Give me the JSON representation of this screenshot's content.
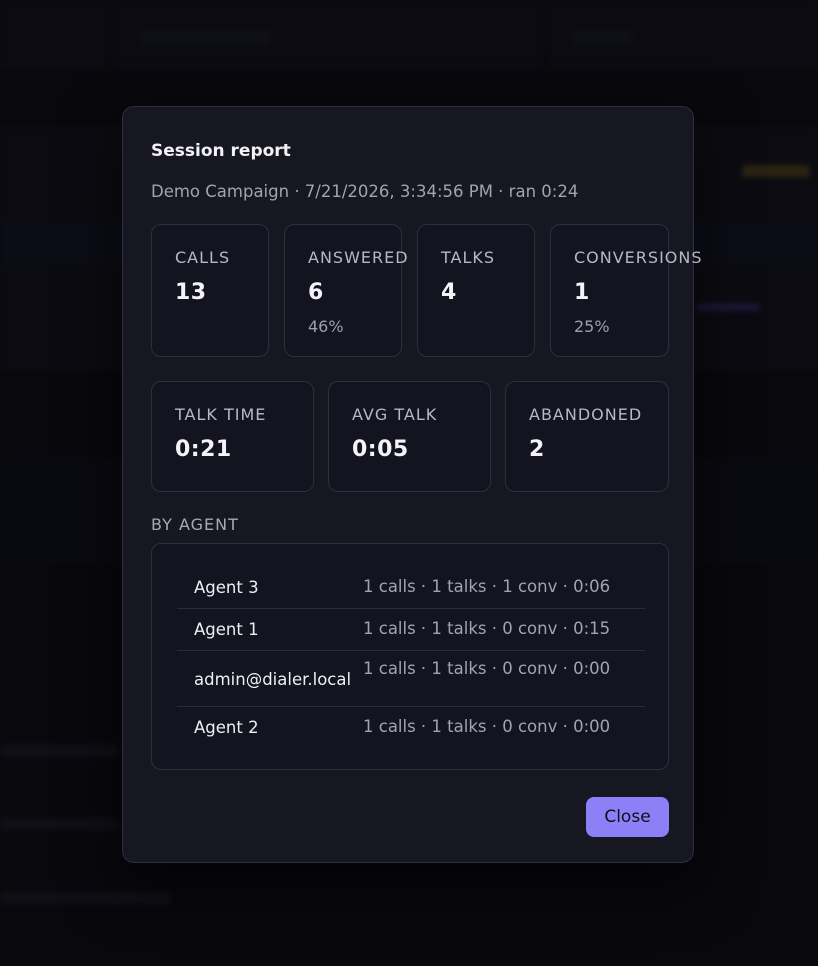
{
  "modal": {
    "title": "Session report",
    "subtitle": "Demo Campaign · 7/21/2026, 3:34:56 PM · ran 0:24",
    "stats_top": [
      {
        "label": "CALLS",
        "value": "13",
        "sub": ""
      },
      {
        "label": "ANSWERED",
        "value": "6",
        "sub": "46%"
      },
      {
        "label": "TALKS",
        "value": "4",
        "sub": ""
      },
      {
        "label": "CONVERSIONS",
        "value": "1",
        "sub": "25%"
      }
    ],
    "stats_bottom": [
      {
        "label": "TALK TIME",
        "value": "0:21"
      },
      {
        "label": "AVG TALK",
        "value": "0:05"
      },
      {
        "label": "ABANDONED",
        "value": "2"
      }
    ],
    "by_agent_label": "BY AGENT",
    "agents": [
      {
        "name": "Agent 3",
        "stats": "1 calls · 1 talks · 1 conv · 0:06"
      },
      {
        "name": "Agent 1",
        "stats": "1 calls · 1 talks · 0 conv · 0:15"
      },
      {
        "name": "admin@dialer.local",
        "stats": "1 calls · 1 talks · 0 conv · 0:00"
      },
      {
        "name": "Agent 2",
        "stats": "1 calls · 1 talks · 0 conv · 0:00"
      }
    ],
    "close_label": "Close"
  },
  "colors": {
    "accent": "#8b80f6",
    "modal_bg": "#171722",
    "card_border": "#2e2e3d"
  }
}
